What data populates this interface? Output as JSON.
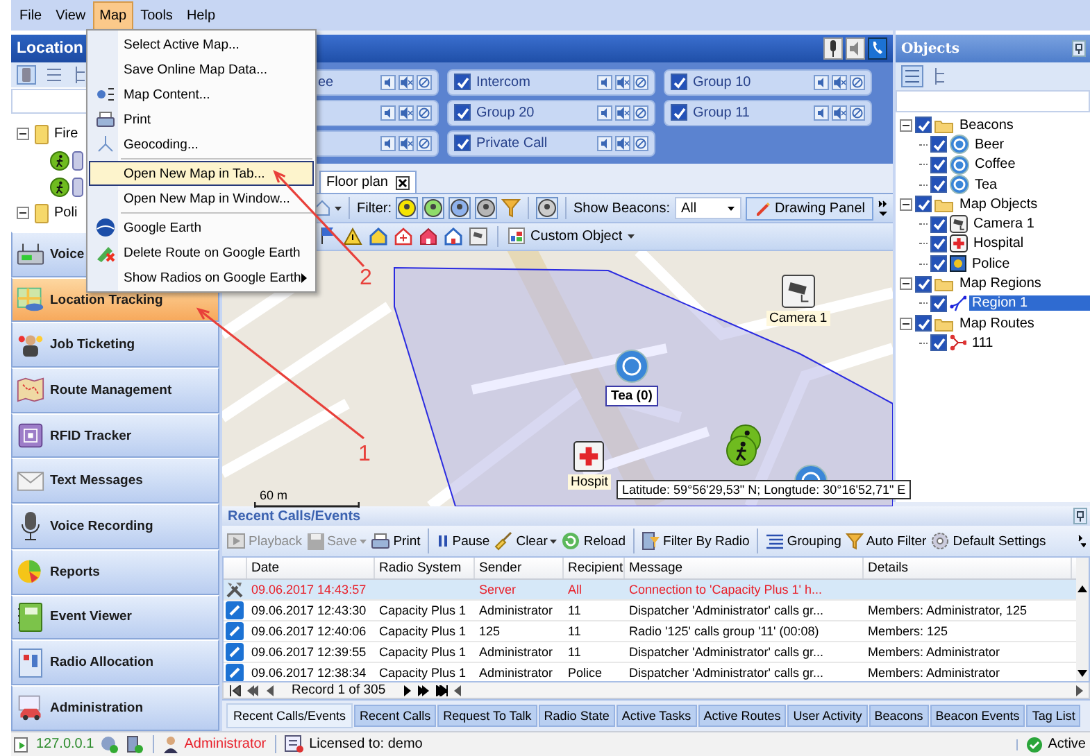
{
  "menu_bar": {
    "items": [
      {
        "label": "File",
        "selected": false
      },
      {
        "label": "View",
        "selected": false
      },
      {
        "label": "Map",
        "selected": true
      },
      {
        "label": "Tools",
        "selected": false
      },
      {
        "label": "Help",
        "selected": false
      }
    ]
  },
  "open_menu": {
    "items": [
      {
        "kind": "item",
        "label": "Select Active Map...",
        "highlighted": false
      },
      {
        "kind": "item",
        "label": "Save Online Map Data...",
        "highlighted": false
      },
      {
        "kind": "item",
        "label": "Map Content...",
        "highlighted": false
      },
      {
        "kind": "item",
        "label": "Print",
        "highlighted": false
      },
      {
        "kind": "item",
        "label": "Geocoding...",
        "highlighted": false
      },
      {
        "kind": "separator"
      },
      {
        "kind": "item",
        "label": "Open New Map in Tab...",
        "highlighted": true
      },
      {
        "kind": "item",
        "label": "Open New Map in Window...",
        "highlighted": false
      },
      {
        "kind": "separator"
      },
      {
        "kind": "item",
        "label": "Google Earth",
        "highlighted": false
      },
      {
        "kind": "item",
        "label": "Delete Route on Google Earth",
        "highlighted": false
      },
      {
        "kind": "submenu",
        "label": "Show Radios on Google Earth",
        "highlighted": false
      }
    ]
  },
  "left_panel": {
    "title": "Location",
    "tree": [
      {
        "label": "Fire",
        "expanded": true,
        "children": [
          {
            "kind": "radio"
          },
          {
            "kind": "radio"
          }
        ]
      },
      {
        "label": "Poli",
        "expanded": true
      }
    ]
  },
  "nav": [
    {
      "label": "Voice",
      "selected": false
    },
    {
      "label": "Location Tracking",
      "selected": true
    },
    {
      "label": "Job Ticketing",
      "selected": false
    },
    {
      "label": "Route Management",
      "selected": false
    },
    {
      "label": "RFID Tracker",
      "selected": false
    },
    {
      "label": "Text Messages",
      "selected": false
    },
    {
      "label": "Voice Recording",
      "selected": false
    },
    {
      "label": "Reports",
      "selected": false
    },
    {
      "label": "Event Viewer",
      "selected": false
    },
    {
      "label": "Radio Allocation",
      "selected": false
    },
    {
      "label": "Administration",
      "selected": false
    }
  ],
  "map_window": {
    "groups": [
      {
        "kind": "group",
        "label": "ee",
        "covered": true
      },
      {
        "kind": "group"
      },
      {
        "kind": "group"
      },
      {
        "kind": "group",
        "label": "Intercom",
        "checked": true,
        "covered": false
      },
      {
        "kind": "group",
        "label": "Group 20",
        "checked": true,
        "covered": false
      },
      {
        "kind": "group",
        "label": "Private Call",
        "checked": true,
        "covered": false
      },
      {
        "kind": "group",
        "label": "Group 10",
        "checked": true,
        "covered": false
      },
      {
        "kind": "group",
        "label": "Group 11",
        "checked": true,
        "covered": false
      }
    ],
    "tabs": [
      {
        "label": "Floor plan",
        "selected": true
      }
    ],
    "filter_label": "Filter:",
    "beacons_label": "Show Beacons:",
    "beacons_value": "All",
    "drawing_button": "Drawing Panel",
    "custom_object": "Custom Object",
    "markers": [
      {
        "kind": "camera",
        "label": "Camera 1"
      },
      {
        "kind": "beacon",
        "label": "Tea (0)"
      },
      {
        "kind": "hospital",
        "label": "Hospit"
      },
      {
        "kind": "person"
      },
      {
        "kind": "person"
      },
      {
        "kind": "beacon"
      }
    ],
    "scale": "60 m",
    "tooltip": "Latitude: 59°56'29,53\" N; Longtude: 30°16'52,71\" E"
  },
  "objects_panel": {
    "title": "Objects",
    "tree": [
      {
        "label": "Beacons",
        "kind": "folder",
        "checked": true,
        "expanded": true,
        "selected": false,
        "children": [
          {
            "label": "Beer",
            "kind": "beacon",
            "checked": true,
            "selected": false
          },
          {
            "label": "Coffee",
            "kind": "beacon",
            "checked": true,
            "selected": false
          },
          {
            "label": "Tea",
            "kind": "beacon",
            "checked": true,
            "selected": false
          }
        ]
      },
      {
        "label": "Map Objects",
        "kind": "folder",
        "checked": true,
        "expanded": true,
        "selected": false,
        "children": [
          {
            "label": "Camera 1",
            "kind": "camera",
            "checked": true,
            "selected": false
          },
          {
            "label": "Hospital",
            "kind": "hospital",
            "checked": true,
            "selected": false
          },
          {
            "label": "Police",
            "kind": "police",
            "checked": true,
            "selected": false
          }
        ]
      },
      {
        "label": "Map Regions",
        "kind": "folder",
        "checked": true,
        "expanded": true,
        "selected": false,
        "children": [
          {
            "label": "Region 1",
            "kind": "region",
            "checked": true,
            "selected": true
          }
        ]
      },
      {
        "label": "Map Routes",
        "kind": "folder",
        "checked": true,
        "expanded": true,
        "selected": false,
        "children": [
          {
            "label": "111",
            "kind": "route",
            "checked": true,
            "selected": false
          }
        ]
      }
    ]
  },
  "events_panel": {
    "title": "Recent Calls/Events",
    "toolbar": [
      {
        "label": "Playback",
        "disabled": true,
        "dropdown": false
      },
      {
        "label": "Save",
        "disabled": true,
        "dropdown": true
      },
      {
        "label": "Print",
        "disabled": false,
        "dropdown": false
      },
      {
        "label": "Pause",
        "disabled": false,
        "dropdown": false
      },
      {
        "label": "Clear",
        "disabled": false,
        "dropdown": true
      },
      {
        "label": "Reload",
        "disabled": false,
        "dropdown": false
      },
      {
        "label": "Filter By Radio",
        "disabled": false,
        "dropdown": false
      },
      {
        "label": "Grouping",
        "disabled": false,
        "dropdown": false
      },
      {
        "label": "Auto Filter",
        "disabled": false,
        "dropdown": false
      },
      {
        "label": "Default Settings",
        "disabled": false,
        "dropdown": false
      }
    ],
    "columns": [
      "Date",
      "Radio System",
      "Sender",
      "Recipient",
      "Message",
      "Details"
    ],
    "rows": [
      {
        "kind": "system",
        "selected": true,
        "date": "09.06.2017 14:43:57",
        "sender": "Server",
        "recipient": "All",
        "message": "Connection to 'Capacity Plus 1' h..."
      },
      {
        "kind": "call",
        "selected": false,
        "date": "09.06.2017 12:43:30",
        "radio_system": "Capacity Plus 1",
        "sender": "Administrator",
        "recipient": "11",
        "message": "Dispatcher 'Administrator' calls gr...",
        "details": "Members: Administrator, 125"
      },
      {
        "kind": "call",
        "selected": false,
        "date": "09.06.2017 12:40:06",
        "radio_system": "Capacity Plus 1",
        "sender": "125",
        "recipient": "11",
        "message": "Radio '125' calls group '11' (00:08)",
        "details": "Members: 125"
      },
      {
        "kind": "call",
        "selected": false,
        "date": "09.06.2017 12:39:55",
        "radio_system": "Capacity Plus 1",
        "sender": "Administrator",
        "recipient": "11",
        "message": "Dispatcher 'Administrator' calls gr...",
        "details": "Members: Administrator"
      },
      {
        "kind": "call",
        "selected": false,
        "date": "09.06.2017 12:38:34",
        "radio_system": "Capacity Plus 1",
        "sender": "Administrator",
        "recipient": "Police",
        "message": "Dispatcher 'Administrator' calls gr...",
        "details": "Members: Administrator"
      }
    ],
    "pager": "Record 1 of 305",
    "tabs": [
      {
        "label": "Recent Calls/Events",
        "selected": true
      },
      {
        "label": "Recent Calls",
        "selected": false
      },
      {
        "label": "Request To Talk",
        "selected": false
      },
      {
        "label": "Radio State",
        "selected": false
      },
      {
        "label": "Active Tasks",
        "selected": false
      },
      {
        "label": "Active Routes",
        "selected": false
      },
      {
        "label": "User Activity",
        "selected": false
      },
      {
        "label": "Beacons",
        "selected": false
      },
      {
        "label": "Beacon Events",
        "selected": false
      },
      {
        "label": "Tag List",
        "selected": false
      }
    ]
  },
  "status_bar": {
    "address": "127.0.0.1",
    "user": "Administrator",
    "license": "Licensed to: demo",
    "state": "Active"
  },
  "annotations": [
    {
      "label": "2"
    },
    {
      "label": "1"
    }
  ]
}
